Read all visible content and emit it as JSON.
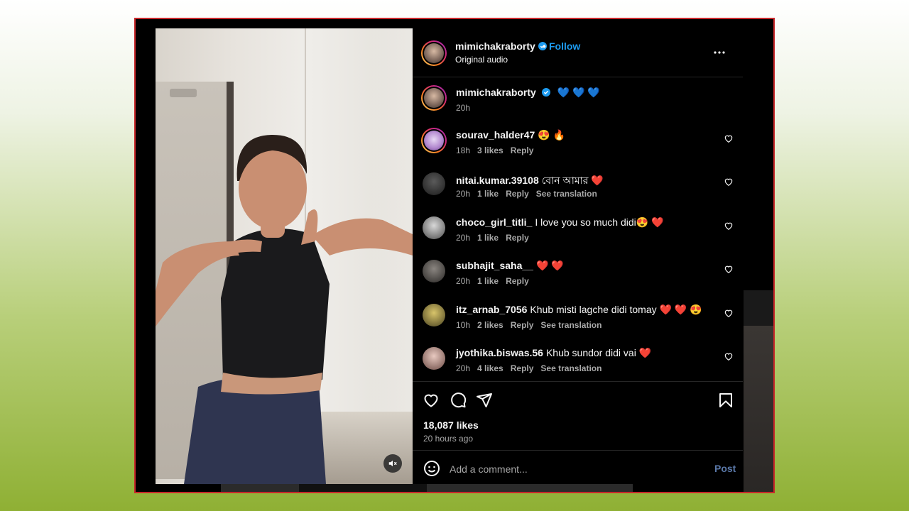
{
  "post": {
    "author": "mimichakraborty",
    "follow_label": "Follow",
    "separator": "•",
    "audio": "Original audio",
    "likes": "18,087 likes",
    "time_ago": "20 hours ago"
  },
  "caption": {
    "username": "mimichakraborty",
    "text": "💙 💙 💙",
    "time": "20h"
  },
  "comments": [
    {
      "username": "sourav_halder47",
      "text": "😍 🔥",
      "time": "18h",
      "likes": "3 likes",
      "reply": "Reply",
      "translation": ""
    },
    {
      "username": "nitai.kumar.39108",
      "text": "বোন আমার ❤️",
      "time": "20h",
      "likes": "1 like",
      "reply": "Reply",
      "translation": "See translation"
    },
    {
      "username": "choco_girl_titli_",
      "text": "I love you so much didi😍 ❤️",
      "time": "20h",
      "likes": "1 like",
      "reply": "Reply",
      "translation": ""
    },
    {
      "username": "subhajit_saha__",
      "text": "❤️ ❤️",
      "time": "20h",
      "likes": "1 like",
      "reply": "Reply",
      "translation": ""
    },
    {
      "username": "itz_arnab_7056",
      "text": "Khub misti lagche didi tomay ❤️ ❤️ 😍",
      "time": "10h",
      "likes": "2 likes",
      "reply": "Reply",
      "translation": "See translation"
    },
    {
      "username": "jyothika.biswas.56",
      "text": "Khub sundor didi vai ❤️",
      "time": "20h",
      "likes": "4 likes",
      "reply": "Reply",
      "translation": "See translation"
    }
  ],
  "add_comment": {
    "placeholder": "Add a comment...",
    "post_label": "Post"
  },
  "icons": {
    "verified": "verified-badge-icon",
    "more": "more-options-icon",
    "like": "heart-icon",
    "comment": "comment-icon",
    "share": "share-icon",
    "save": "bookmark-icon",
    "emoji": "smiley-icon",
    "mute": "muted-speaker-icon"
  },
  "colors": {
    "accent": "#1d9bf0",
    "frame_border": "#c8282a",
    "panel_bg": "#000000"
  }
}
